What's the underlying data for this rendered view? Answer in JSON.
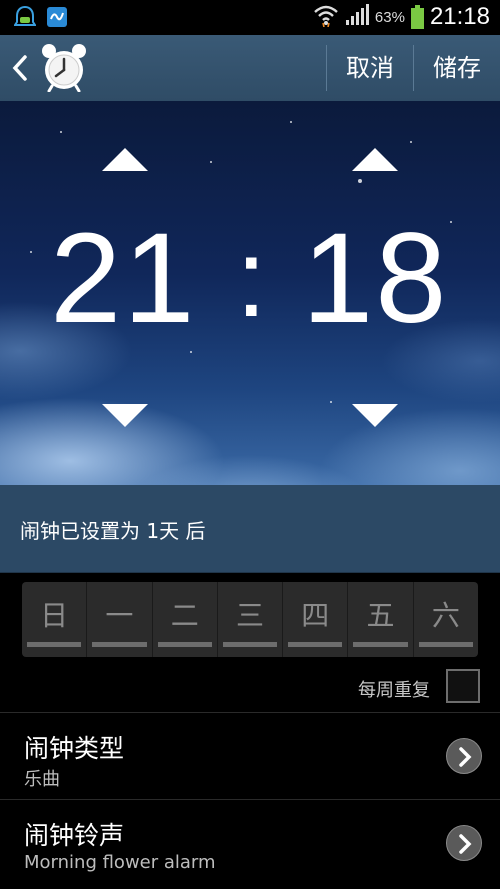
{
  "status_bar": {
    "battery_percent": "63%",
    "time": "21:18"
  },
  "action_bar": {
    "cancel_label": "取消",
    "save_label": "储存"
  },
  "time_picker": {
    "hour": "21",
    "separator": ":",
    "minute": "18"
  },
  "info": {
    "text": "闹钟已设置为 1天 后"
  },
  "days": [
    {
      "label": "日"
    },
    {
      "label": "一"
    },
    {
      "label": "二"
    },
    {
      "label": "三"
    },
    {
      "label": "四"
    },
    {
      "label": "五"
    },
    {
      "label": "六"
    }
  ],
  "repeat": {
    "label": "每周重复"
  },
  "settings": [
    {
      "title": "闹钟类型",
      "value": "乐曲"
    },
    {
      "title": "闹钟铃声",
      "value": "Morning flower alarm"
    }
  ],
  "colors": {
    "action_bar": "#2f4c66",
    "info_bar": "#2c4965",
    "battery": "#7ac943"
  }
}
